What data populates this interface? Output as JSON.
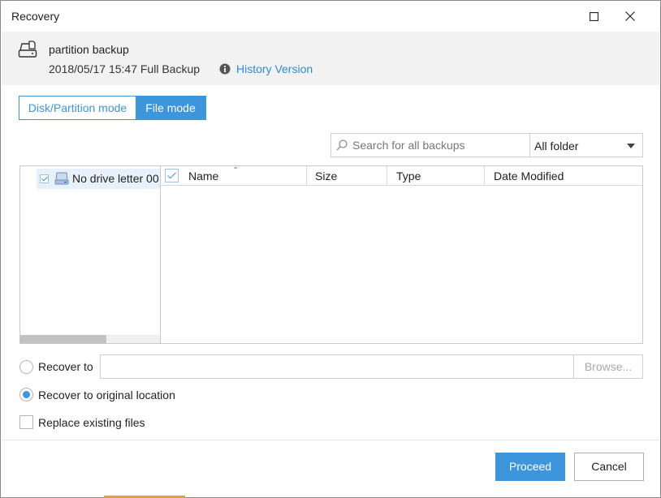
{
  "window": {
    "title": "Recovery",
    "maximize_icon": "maximize-icon",
    "close_icon": "close-icon"
  },
  "backup": {
    "icon": "disk-backup-icon",
    "name": "partition backup",
    "date_type": "2018/05/17 15:47 Full Backup",
    "info_icon": "info-icon",
    "history_link": "History Version"
  },
  "modes": {
    "disk_partition": "Disk/Partition mode",
    "file": "File mode",
    "selected": "File mode"
  },
  "search": {
    "placeholder": "Search for all backups",
    "value": ""
  },
  "folder_filter": {
    "selected": "All folder"
  },
  "tree": {
    "items": [
      {
        "label": "No drive letter 00",
        "checked": true,
        "icon": "drive-icon"
      }
    ]
  },
  "file_table": {
    "header_checked": true,
    "columns": [
      "Name",
      "Size",
      "Type",
      "Date Modified"
    ],
    "sort_column": "Name",
    "rows": []
  },
  "options": {
    "recover_to_label": "Recover to",
    "recover_to_path": "",
    "browse_label": "Browse...",
    "recover_original_label": "Recover to original location",
    "selected": "original",
    "replace_existing_label": "Replace existing files",
    "replace_existing_checked": false
  },
  "footer": {
    "proceed_label": "Proceed",
    "cancel_label": "Cancel"
  },
  "colors": {
    "accent": "#3d95dc",
    "link": "#2f8ad8",
    "header_band": "#f2f2f2"
  }
}
